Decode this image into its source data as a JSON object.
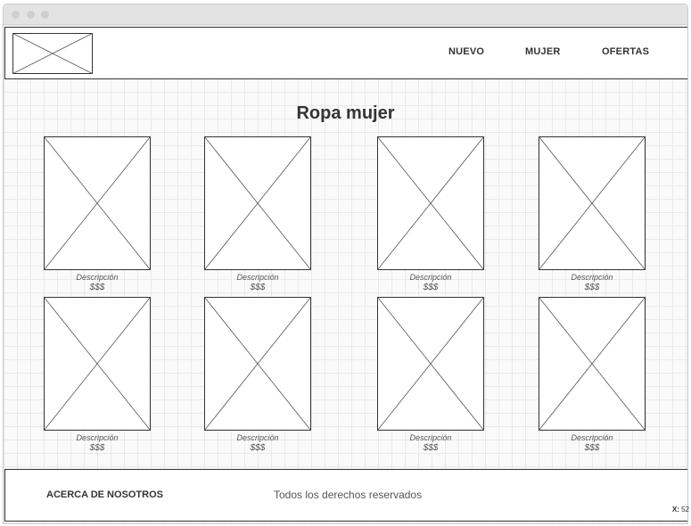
{
  "navbar": {
    "links": [
      "NUEVO",
      "MUJER",
      "OFERTAS"
    ]
  },
  "main": {
    "title": "Ropa mujer",
    "products": [
      {
        "description": "Descripción",
        "price": "$$$"
      },
      {
        "description": "Descripción",
        "price": "$$$"
      },
      {
        "description": "Descripción",
        "price": "$$$"
      },
      {
        "description": "Descripción",
        "price": "$$$"
      },
      {
        "description": "Descripción",
        "price": "$$$"
      },
      {
        "description": "Descripción",
        "price": "$$$"
      },
      {
        "description": "Descripción",
        "price": "$$$"
      },
      {
        "description": "Descripción",
        "price": "$$$"
      }
    ]
  },
  "footer": {
    "about_label": "ACERCA DE NOSOTROS",
    "copyright": "Todos los derechos reservados"
  },
  "status": {
    "x_label": "X:",
    "x_value": "52"
  }
}
